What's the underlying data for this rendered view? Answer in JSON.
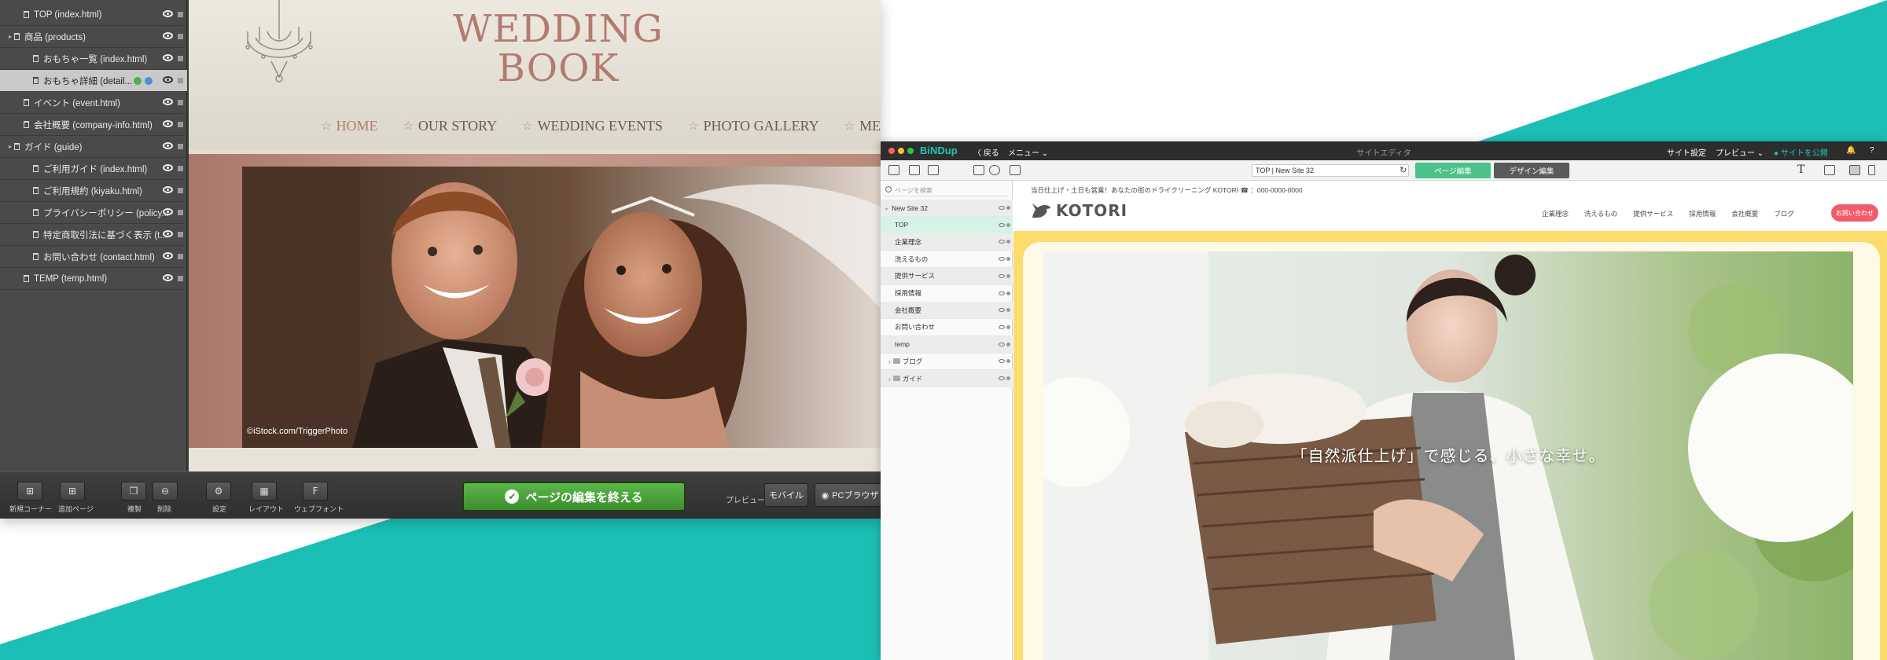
{
  "colors": {
    "teal": "#1bbfb5",
    "finish_green": "#3c8d2d",
    "page_edit_green": "#4cc28a",
    "brand_teal": "#21c4b3",
    "wedding_title": "#b27b6f",
    "kotori_yellow": "#fbdc6c",
    "contact_red": "#f05d6a"
  },
  "left_app": {
    "tree": [
      {
        "label": "TOP (index.html)",
        "indent": 1
      },
      {
        "label": "商品 (products)",
        "indent": 0,
        "twist": "▸"
      },
      {
        "label": "おもちゃ一覧 (index.html)",
        "indent": 2
      },
      {
        "label": "おもちゃ詳細 (detail...",
        "indent": 2,
        "selected": true
      },
      {
        "label": "イベント (event.html)",
        "indent": 1
      },
      {
        "label": "会社概要 (company-info.html)",
        "indent": 1
      },
      {
        "label": "ガイド (guide)",
        "indent": 0,
        "twist": "▸"
      },
      {
        "label": "ご利用ガイド (index.html)",
        "indent": 2
      },
      {
        "label": "ご利用規約 (kiyaku.html)",
        "indent": 2
      },
      {
        "label": "プライバシーポリシー (policy...",
        "indent": 2
      },
      {
        "label": "特定商取引法に基づく表示 (t...",
        "indent": 2
      },
      {
        "label": "お問い合わせ (contact.html)",
        "indent": 2
      },
      {
        "label": "TEMP (temp.html)",
        "indent": 1
      }
    ],
    "preview": {
      "title_line1": "WEDDING",
      "title_line2": "BOOK",
      "nav": [
        "HOME",
        "OUR STORY",
        "WEDDING EVENTS",
        "PHOTO GALLERY",
        "MESSAGE"
      ],
      "photo_credit": "©iStock.com/TriggerPhoto"
    },
    "toolbar": {
      "new_corner": "新規コーナー",
      "add_page": "追加ページ",
      "duplicate": "複製",
      "delete": "削除",
      "settings": "設定",
      "layout": "レイアウト",
      "webfont": "ウェブフォント",
      "finish": "ページの編集を終える",
      "preview_label": "プレビュー",
      "mobile": "モバイル",
      "pc_browser": "PCブラウザ"
    }
  },
  "right_app": {
    "brand": "BiNDup",
    "back": "〈 戻る",
    "menu": "メニュー ⌄",
    "app_title": "サイトエディタ",
    "site_settings": "サイト設定",
    "preview": "プレビュー ⌄",
    "publish": "サイトを公開",
    "url": "TOP | New Site 32",
    "page_edit": "ページ編集",
    "design_edit": "デザイン編集",
    "font_t": "T",
    "search_placeholder": "ページを検索",
    "site_tree": [
      {
        "label": "New Site 32",
        "twist": "⌄"
      },
      {
        "label": "TOP",
        "active": true
      },
      {
        "label": "企業理念"
      },
      {
        "label": "洗えるもの"
      },
      {
        "label": "提供サービス"
      },
      {
        "label": "採用情報"
      },
      {
        "label": "会社概要"
      },
      {
        "label": "お問い合わせ"
      },
      {
        "label": "temp"
      },
      {
        "label": "ブログ",
        "folder": true
      },
      {
        "label": "ガイド",
        "folder": true
      }
    ],
    "site": {
      "announcement": "当日仕上げ・土日も営業！あなたの街のドライクリーニング KOTORI ☎ ：000-0000-0000",
      "logo": "KOTORI",
      "nav": [
        "企業理念",
        "洗えるもの",
        "提供サービス",
        "採用情報",
        "会社概要",
        "ブログ"
      ],
      "contact": "お問い合わせ",
      "hero_caption": "「自然派仕上げ」で感じる、小さな幸せ。"
    }
  }
}
